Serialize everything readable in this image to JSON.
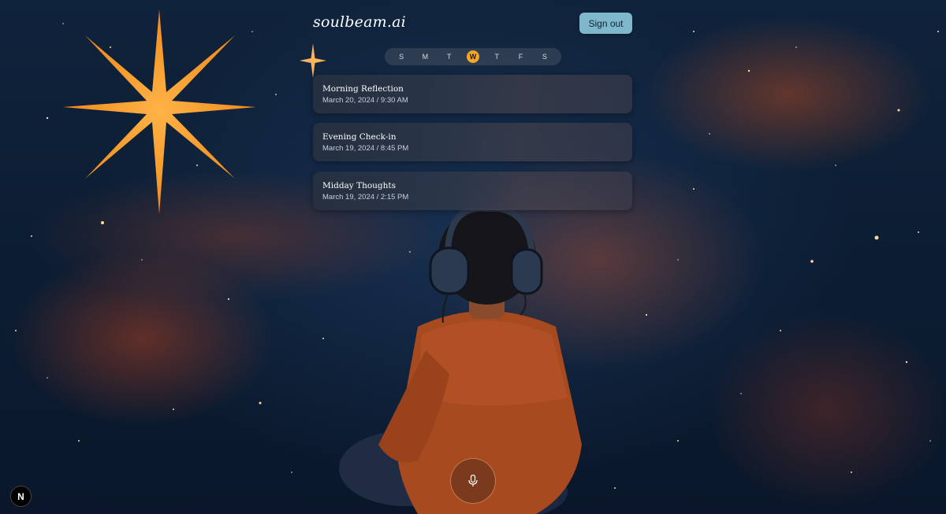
{
  "app": {
    "logo": "soulbeam.ai"
  },
  "header": {
    "signout_label": "Sign out"
  },
  "week": {
    "days": [
      "S",
      "M",
      "T",
      "W",
      "T",
      "F",
      "S"
    ],
    "active_index": 3
  },
  "entries": [
    {
      "title": "Morning Reflection",
      "meta": "March 20, 2024 / 9:30 AM"
    },
    {
      "title": "Evening Check-in",
      "meta": "March 19, 2024 / 8:45 PM"
    },
    {
      "title": "Midday Thoughts",
      "meta": "March 19, 2024 / 2:15 PM"
    }
  ],
  "controls": {
    "mic_icon": "microphone-icon",
    "badge_label": "N"
  },
  "colors": {
    "accent": "#f5a623",
    "signout_bg": "#7fb8cc",
    "background": "#0b1a2e"
  }
}
